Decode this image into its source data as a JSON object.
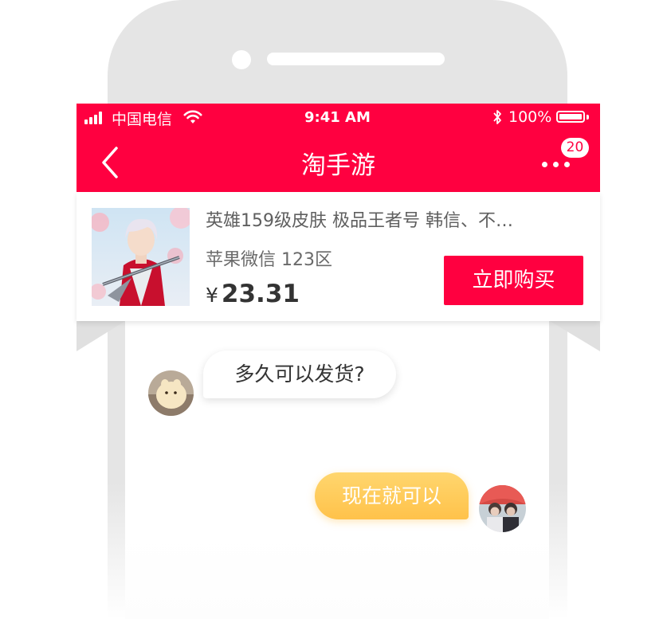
{
  "status_bar": {
    "carrier": "中国电信",
    "time": "9:41 AM",
    "battery": "100%"
  },
  "nav": {
    "title": "淘手游",
    "badge_count": "20"
  },
  "product": {
    "name": "英雄159级皮肤 极品王者号 韩信、不…",
    "server": "苹果微信 123区",
    "currency": "¥",
    "price": "23.31",
    "buy_label": "立即购买"
  },
  "messages": [
    {
      "direction": "incoming",
      "text": "多久可以发货?"
    },
    {
      "direction": "outgoing",
      "text": "现在就可以"
    }
  ],
  "colors": {
    "primary": "#ff0040",
    "outgoing_bubble": "#ffc24a",
    "phone_frame": "#e5e5e5"
  },
  "icons": [
    "signal-icon",
    "wifi-icon",
    "bluetooth-icon",
    "battery-icon",
    "back-arrow-icon",
    "more-icon"
  ]
}
